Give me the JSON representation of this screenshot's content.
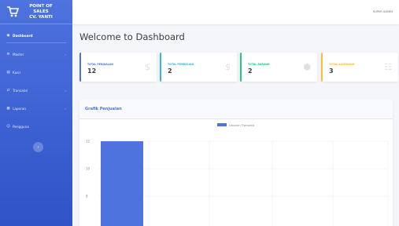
{
  "brand": {
    "line1": "POINT OF",
    "line2": "SALES",
    "line3": "CV. YANTI"
  },
  "sidebar": {
    "items": [
      {
        "label": "Dashboard",
        "icon": "tachometer-icon",
        "active": true,
        "chevron": false
      },
      {
        "label": "Master",
        "icon": "cog-icon",
        "active": false,
        "chevron": true
      },
      {
        "label": "Kasir",
        "icon": "cash-register-icon",
        "active": false,
        "chevron": false
      },
      {
        "label": "Transaksi",
        "icon": "exchange-icon",
        "active": false,
        "chevron": true
      },
      {
        "label": "Laporan",
        "icon": "table-icon",
        "active": false,
        "chevron": true
      },
      {
        "label": "Pengguna",
        "icon": "user-icon",
        "active": false,
        "chevron": false
      }
    ],
    "toggle_icon": "chevron-left-icon"
  },
  "topbar": {
    "user": "SUPER ADMIN"
  },
  "page_title": "Welcome to Dashboard",
  "cards": [
    {
      "label": "TOTAL PENJUALAN",
      "value": "12",
      "accent": "#4e73df",
      "icon": "dollar-icon"
    },
    {
      "label": "TOTAL PEMBELIAN",
      "value": "2",
      "accent": "#36b9cc",
      "icon": "dollar-icon"
    },
    {
      "label": "TOTAL BARANG",
      "value": "2",
      "accent": "#1cc88a",
      "icon": "box-icon"
    },
    {
      "label": "TOTAL KARYAWAN",
      "value": "3",
      "accent": "#f6c23e",
      "icon": "users-icon"
    }
  ],
  "chart_header": "Grafik Penjualan",
  "chart_data": {
    "type": "bar",
    "categories": [
      ""
    ],
    "series": [
      {
        "name": "Laporan Transaksi",
        "values": [
          12
        ],
        "color": "#4e73df"
      }
    ],
    "y_ticks": [
      12,
      10,
      8
    ],
    "ylim": [
      7,
      12
    ],
    "grid": true,
    "legend": "top-center"
  }
}
